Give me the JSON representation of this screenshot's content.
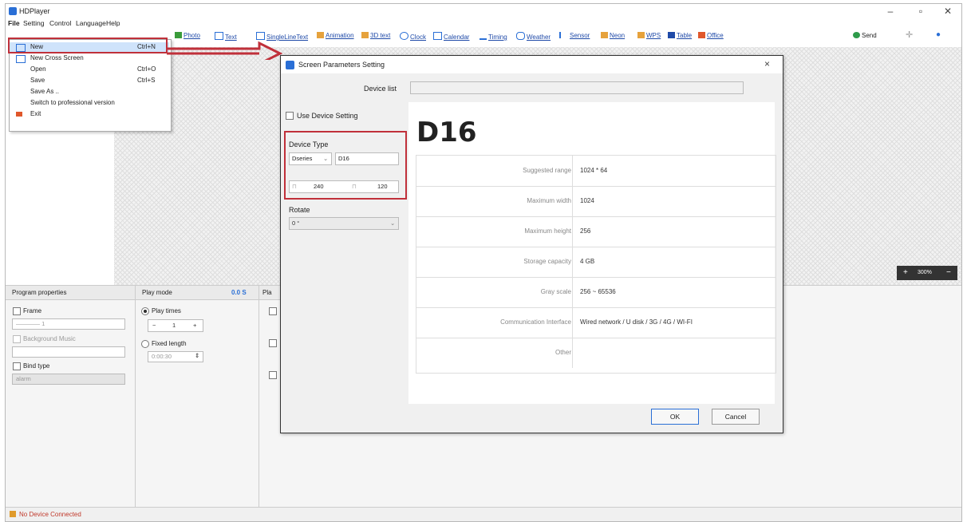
{
  "window": {
    "title": "HDPlayer",
    "controls": [
      "–",
      "▫",
      "✕"
    ]
  },
  "menubar": [
    "File",
    "Setting",
    "Control",
    "Language",
    "Help"
  ],
  "file_menu": [
    {
      "label": "New",
      "shortcut": "Ctrl+N"
    },
    {
      "label": "New Cross Screen",
      "shortcut": ""
    },
    {
      "label": "Open",
      "shortcut": "Ctrl+O"
    },
    {
      "label": "Save",
      "shortcut": "Ctrl+S"
    },
    {
      "label": "Save As ..",
      "shortcut": ""
    },
    {
      "label": "Switch to professional version",
      "shortcut": ""
    },
    {
      "label": "Exit",
      "shortcut": ""
    }
  ],
  "toolbar": {
    "items": [
      "Photo",
      "Text",
      "SingleLineText",
      "Animation",
      "3D text",
      "Clock",
      "Calendar",
      "Timing",
      "Weather",
      "Sensor",
      "Neon",
      "WPS",
      "Table",
      "Office"
    ],
    "send": "Send",
    "zoom": "300%"
  },
  "program_panel": {
    "headers": {
      "program": "Program properties",
      "play": "Play mode",
      "time": "0.0 S",
      "third": "Pla"
    },
    "frame": "Frame",
    "frame_value": "———— 1",
    "background_music": "Background Music",
    "bind_type": "Bind type",
    "bind_value": "alarm",
    "play_times": "Play times",
    "play_times_value": "1",
    "fixed_length": "Fixed length",
    "fixed_length_value": "0:00:30"
  },
  "status": "No Device Connected",
  "dialog": {
    "title": "Screen Parameters Setting",
    "device_list_label": "Device list",
    "use_device_setting": "Use Device Setting",
    "device_type_label": "Device Type",
    "series": "Dseries",
    "model": "D16",
    "width": "240",
    "height": "120",
    "rotate_label": "Rotate",
    "rotate_value": "0 °",
    "heading": "D16",
    "specs": [
      {
        "key": "Suggested range",
        "value": "1024 * 64"
      },
      {
        "key": "Maximum width",
        "value": "1024"
      },
      {
        "key": "Maximum height",
        "value": "256"
      },
      {
        "key": "Storage capacity",
        "value": "4 GB"
      },
      {
        "key": "Gray scale",
        "value": "256 ~ 65536"
      },
      {
        "key": "Communication Interface",
        "value": "Wired network / U disk / 3G / 4G / WI-FI"
      },
      {
        "key": "Other",
        "value": ""
      }
    ],
    "ok": "OK",
    "cancel": "Cancel"
  },
  "colors": {
    "annotation_red": "#c0303a",
    "accent_blue": "#2a6fd6",
    "highlight": "#cfe3fb"
  }
}
